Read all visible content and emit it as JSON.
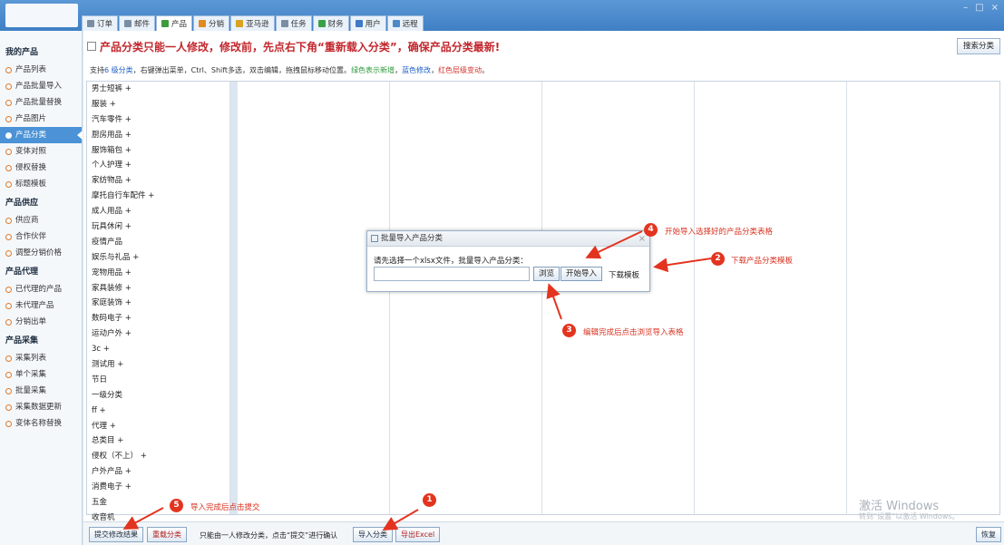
{
  "window": {
    "controls": [
      "–",
      "□",
      "×"
    ]
  },
  "tabs": [
    {
      "label": "订单",
      "color": "#7a8ea3"
    },
    {
      "label": "邮件",
      "color": "#7a8ea3"
    },
    {
      "label": "产品",
      "color": "#3d9a3d"
    },
    {
      "label": "分销",
      "color": "#e08a1f"
    },
    {
      "label": "亚马逊",
      "color": "#d9a21f"
    },
    {
      "label": "任务",
      "color": "#7a8ea3"
    },
    {
      "label": "财务",
      "color": "#3aa046"
    },
    {
      "label": "用户",
      "color": "#4179c4"
    },
    {
      "label": "远程",
      "color": "#4f88c7"
    }
  ],
  "sidebar": {
    "sections": [
      {
        "title": "我的产品",
        "items": [
          "产品列表",
          "产品批量导入",
          "产品批量替换",
          "产品图片",
          "产品分类",
          "变体对照",
          "侵权替换",
          "标题模板"
        ]
      },
      {
        "title": "产品供应",
        "items": [
          "供应商",
          "合作伙伴",
          "调整分销价格"
        ]
      },
      {
        "title": "产品代理",
        "items": [
          "已代理的产品",
          "未代理产品",
          "分销出单"
        ]
      },
      {
        "title": "产品采集",
        "items": [
          "采集列表",
          "单个采集",
          "批量采集",
          "采集数据更新",
          "变体名称替换"
        ]
      }
    ],
    "active_item": "产品分类"
  },
  "main": {
    "notice": "产品分类只能一人修改，修改前，先点右下角“重新载入分类”，确保产品分类最新!",
    "search_button": "搜索分类",
    "hint": {
      "p1": "支持",
      "levels": "6 级分类",
      "p2": "，右键弹出菜单，Ctrl、Shift多选，双击编辑，拖拽鼠标移动位置。",
      "green": "绿色表示新增",
      "p3": "，",
      "blue": "蓝色修改",
      "p4": "，",
      "red": "红色层级变动",
      "p5": "。"
    },
    "categories": [
      "男士短裤 +",
      "服装 +",
      "汽车零件 +",
      "厨房用品 +",
      "服饰箱包 +",
      "个人护理 +",
      "家纺物品 +",
      "摩托自行车配件 +",
      "成人用品 +",
      "玩具休闲 +",
      "疫情产品",
      "娱乐与礼品 +",
      "宠物用品 +",
      "家具装修 +",
      "家庭装饰 +",
      "数码电子 +",
      "运动户外 +",
      "3c +",
      "测试用 +",
      "节日",
      "一级分类",
      "ff +",
      "代理 +",
      "总类目 +",
      "侵权（不上） +",
      "户外产品 +",
      "消费电子 +",
      "五金",
      "收音机",
      "拐棍"
    ]
  },
  "bottom": {
    "submit": "提交修改结果",
    "reload": "重载分类",
    "note": "只能由一人修改分类，点击“提交”进行确认",
    "import": "导入分类",
    "export": "导出Excel",
    "restore": "恢复"
  },
  "dialog": {
    "title": "批量导入产品分类",
    "close": "×",
    "prompt": "请先选择一个xlsx文件，批量导入产品分类：",
    "input_value": "",
    "browse": "浏览",
    "start": "开始导入",
    "template": "下载模板"
  },
  "annotations": [
    {
      "num": "1",
      "text": ""
    },
    {
      "num": "2",
      "text": "下载产品分类模板"
    },
    {
      "num": "3",
      "text": "编辑完成后点击浏览导入表格"
    },
    {
      "num": "4",
      "text": "开始导入选择好的产品分类表格"
    },
    {
      "num": "5",
      "text": "导入完成后点击提交"
    }
  ],
  "watermark": {
    "line1": "激活 Windows",
    "line2": "转到“设置”以激活 Windows。"
  },
  "colors": {
    "accent": "#4b93d6",
    "annotation": "#e3341f",
    "notice": "#c2272d"
  }
}
